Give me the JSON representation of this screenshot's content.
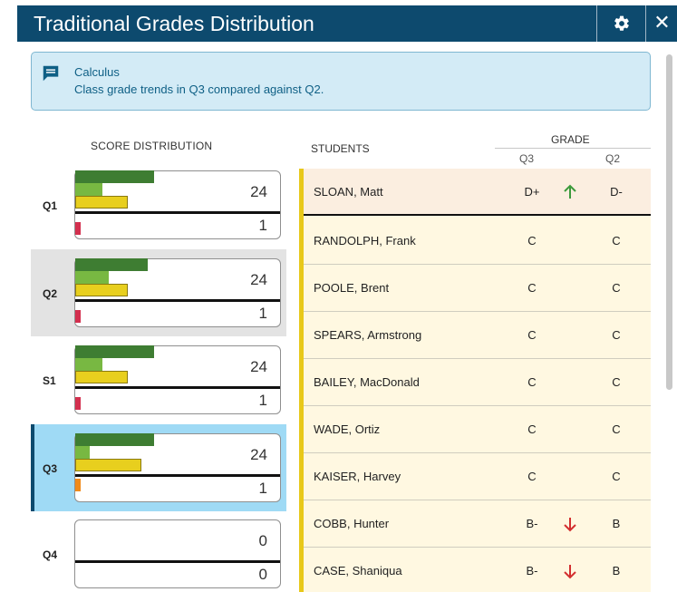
{
  "header": {
    "title": "Traditional Grades Distribution",
    "settings_icon": "gear-icon",
    "close_label": "✕"
  },
  "info": {
    "icon": "message-icon",
    "course": "Calculus",
    "description": "Class grade trends in Q3 compared against Q2."
  },
  "columns": {
    "score_distribution": "SCORE DISTRIBUTION",
    "students": "STUDENTS",
    "grade": "GRADE",
    "q3": "Q3",
    "q2": "Q2"
  },
  "periods": [
    {
      "label": "Q1",
      "top": "24",
      "bottom": "1"
    },
    {
      "label": "Q2",
      "top": "24",
      "bottom": "1"
    },
    {
      "label": "S1",
      "top": "24",
      "bottom": "1"
    },
    {
      "label": "Q3",
      "top": "24",
      "bottom": "1"
    },
    {
      "label": "Q4",
      "top": "0",
      "bottom": "0"
    }
  ],
  "students": [
    {
      "name": "SLOAN, Matt",
      "q3": "D+",
      "trend": "up",
      "q2": "D-"
    },
    {
      "name": "RANDOLPH, Frank",
      "q3": "C",
      "trend": "",
      "q2": "C"
    },
    {
      "name": "POOLE, Brent",
      "q3": "C",
      "trend": "",
      "q2": "C"
    },
    {
      "name": "SPEARS, Armstrong",
      "q3": "C",
      "trend": "",
      "q2": "C"
    },
    {
      "name": "BAILEY, MacDonald",
      "q3": "C",
      "trend": "",
      "q2": "C"
    },
    {
      "name": "WADE, Ortiz",
      "q3": "C",
      "trend": "",
      "q2": "C"
    },
    {
      "name": "KAISER, Harvey",
      "q3": "C",
      "trend": "",
      "q2": "C"
    },
    {
      "name": "COBB, Hunter",
      "q3": "B-",
      "trend": "down",
      "q2": "B"
    },
    {
      "name": "CASE, Shaniqua",
      "q3": "B-",
      "trend": "down",
      "q2": "B"
    }
  ],
  "colors": {
    "header": "#0d4a6e",
    "up": "#3c9a3c",
    "down": "#d32f2f",
    "active_period": "#9fdaf5"
  }
}
